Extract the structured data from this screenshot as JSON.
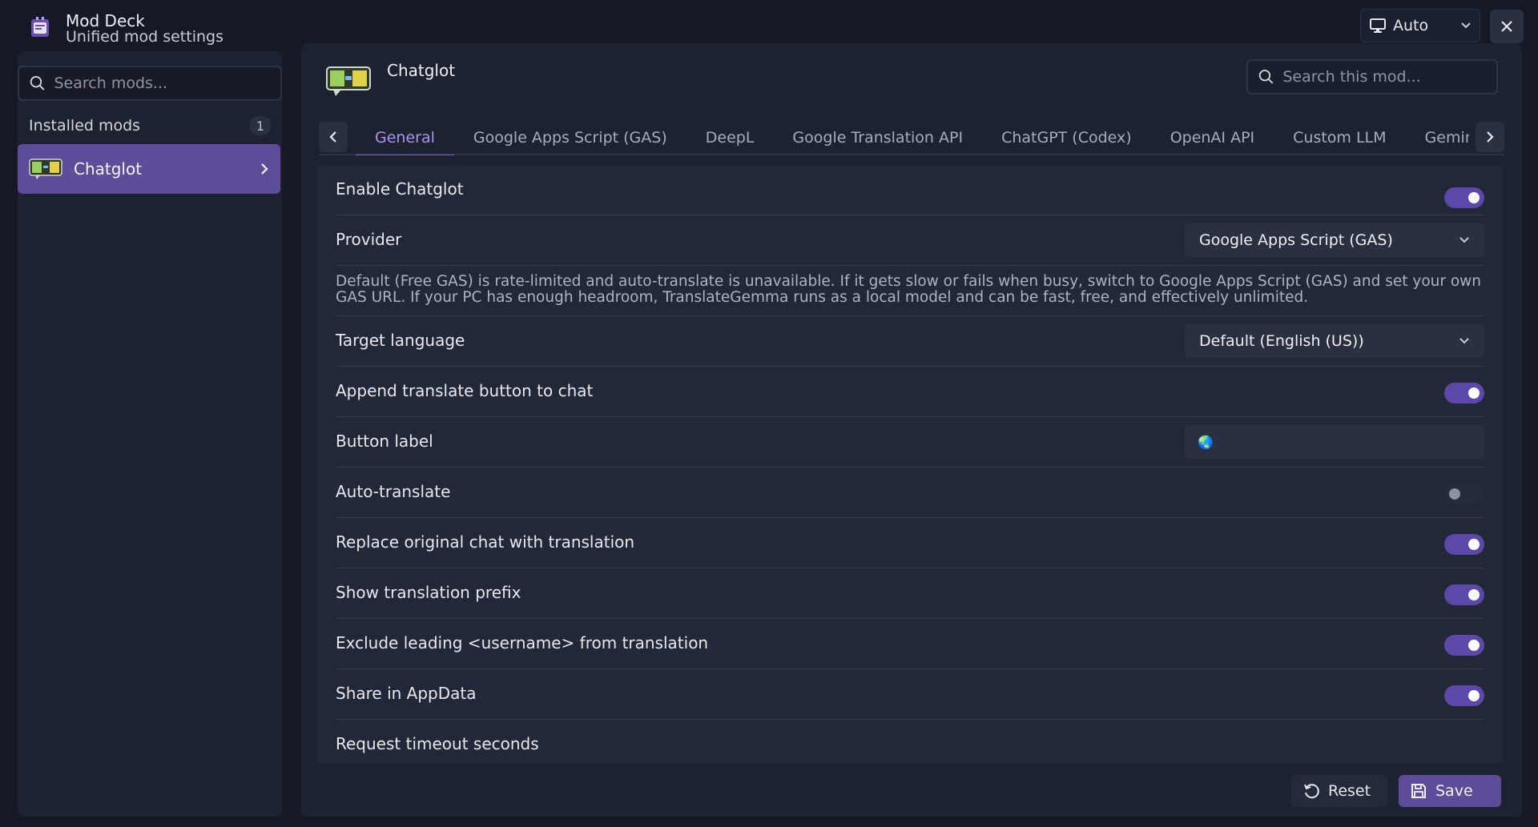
{
  "app": {
    "title": "Mod Deck",
    "subtitle": "Unified mod settings",
    "logo_icon": "app-logo-icon"
  },
  "window_controls": {
    "mode_label": "Auto",
    "mode_icon": "monitor-icon",
    "close_icon": "close-icon"
  },
  "sidebar": {
    "search_placeholder": "Search mods...",
    "installed_label": "Installed mods",
    "installed_count": "1",
    "items": [
      {
        "label": "Chatglot",
        "icon": "chatglot-icon",
        "selected": true
      }
    ]
  },
  "mod": {
    "title": "Chatglot",
    "search_placeholder": "Search this mod...",
    "tabs": [
      "General",
      "Google Apps Script (GAS)",
      "DeepL",
      "Google Translation API",
      "ChatGPT (Codex)",
      "OpenAI API",
      "Custom LLM",
      "Gemini"
    ],
    "active_tab": "General"
  },
  "settings": {
    "enable_label": "Enable Chatglot",
    "enable_value": true,
    "provider_label": "Provider",
    "provider_value": "Google Apps Script (GAS)",
    "provider_note": "Default (Free GAS) is rate-limited and auto-translate is unavailable. If it gets slow or fails when busy, switch to Google Apps Script (GAS) and set your own GAS URL. If your PC has enough headroom, TranslateGemma runs as a local model and can be fast, free, and effectively unlimited.",
    "target_language_label": "Target language",
    "target_language_value": "Default (English (US))",
    "append_button_label": "Append translate button to chat",
    "append_button_value": true,
    "button_label_label": "Button label",
    "button_label_value": "🌏",
    "auto_translate_label": "Auto-translate",
    "auto_translate_value": false,
    "replace_label": "Replace original chat with translation",
    "replace_value": true,
    "prefix_label": "Show translation prefix",
    "prefix_value": true,
    "exclude_label": "Exclude leading <username> from translation",
    "exclude_value": true,
    "share_label": "Share in AppData",
    "share_value": true,
    "timeout_label": "Request timeout seconds"
  },
  "footer": {
    "reset_label": "Reset",
    "save_label": "Save"
  },
  "colors": {
    "accent": "#5f4c98",
    "accent_text": "#a992f0",
    "background": "#151925",
    "panel": "#1d2231",
    "card": "#232838"
  }
}
